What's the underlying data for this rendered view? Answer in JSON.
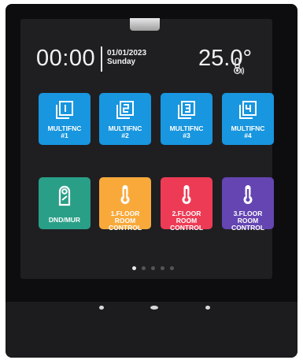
{
  "status": {
    "time": "00:00",
    "date": "01/01/2023",
    "day": "Sunday",
    "temperature": "25.0°"
  },
  "tiles": [
    {
      "icon": "multifunction-1-icon",
      "line1": "MULTIFNC",
      "line2": "#1",
      "color": "#1896df"
    },
    {
      "icon": "multifunction-2-icon",
      "line1": "MULTIFNC",
      "line2": "#2",
      "color": "#1896df"
    },
    {
      "icon": "multifunction-3-icon",
      "line1": "MULTIFNC",
      "line2": "#3",
      "color": "#1896df"
    },
    {
      "icon": "multifunction-4-icon",
      "line1": "MULTIFNC",
      "line2": "#4",
      "color": "#1896df"
    },
    {
      "icon": "door-hanger-icon",
      "line1": "DND/MUR",
      "color": "#2a9f88"
    },
    {
      "icon": "thermometer-icon",
      "line1": "1.FLOOR",
      "line2": "ROOM",
      "line3": "CONTROL",
      "color": "#f8a93a"
    },
    {
      "icon": "thermometer-icon",
      "line1": "2.FLOOR",
      "line2": "ROOM",
      "line3": "CONTROL",
      "color": "#ee3b55"
    },
    {
      "icon": "thermometer-icon",
      "line1": "3.FLOOR",
      "line2": "ROOM",
      "line3": "CONTROL",
      "color": "#6445b1"
    }
  ],
  "pagination": {
    "pages": 5,
    "active_page": 1
  }
}
